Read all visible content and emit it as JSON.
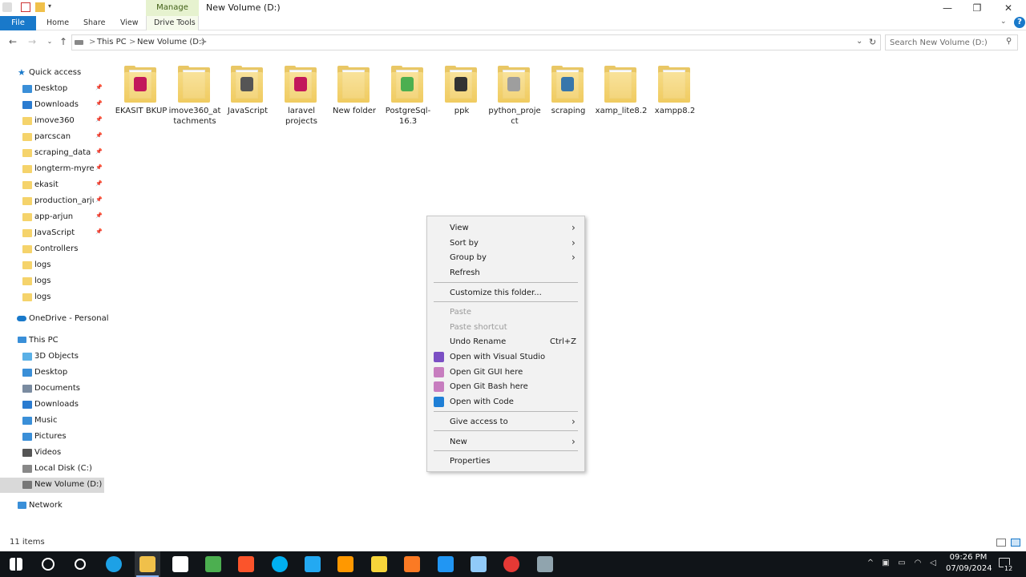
{
  "window": {
    "title": "New Volume (D:)",
    "manage_tab": "Manage",
    "controls": {
      "minimize": "—",
      "maximize": "❐",
      "close": "✕"
    }
  },
  "ribbon": {
    "tabs": [
      {
        "label": "File"
      },
      {
        "label": "Home"
      },
      {
        "label": "Share"
      },
      {
        "label": "View"
      },
      {
        "label": "Drive Tools"
      }
    ],
    "help": "?"
  },
  "address": {
    "crumbs": [
      "This PC",
      "New Volume (D:)"
    ],
    "separator": ">",
    "search_placeholder": "Search New Volume (D:)"
  },
  "nav_pane": {
    "quick_access": "Quick access",
    "quick_items": [
      {
        "label": "Desktop",
        "pinned": true
      },
      {
        "label": "Downloads",
        "pinned": true
      },
      {
        "label": "imove360",
        "pinned": true
      },
      {
        "label": "parcscan",
        "pinned": true
      },
      {
        "label": "scraping_data",
        "pinned": true
      },
      {
        "label": "longterm-myrent",
        "pinned": true
      },
      {
        "label": "ekasit",
        "pinned": true
      },
      {
        "label": "production_arjun",
        "pinned": true
      },
      {
        "label": "app-arjun",
        "pinned": true
      },
      {
        "label": "JavaScript",
        "pinned": true
      },
      {
        "label": "Controllers",
        "pinned": false
      },
      {
        "label": "logs",
        "pinned": false
      },
      {
        "label": "logs",
        "pinned": false
      },
      {
        "label": "logs",
        "pinned": false
      }
    ],
    "onedrive": "OneDrive - Personal",
    "this_pc": "This PC",
    "pc_items": [
      {
        "label": "3D Objects"
      },
      {
        "label": "Desktop"
      },
      {
        "label": "Documents"
      },
      {
        "label": "Downloads"
      },
      {
        "label": "Music"
      },
      {
        "label": "Pictures"
      },
      {
        "label": "Videos"
      },
      {
        "label": "Local Disk (C:)"
      },
      {
        "label": "New Volume (D:)"
      }
    ],
    "network": "Network"
  },
  "files": [
    {
      "name": "EKASIT BKUP",
      "badge": "#c2185b"
    },
    {
      "name": "imove360_attachments",
      "badge": ""
    },
    {
      "name": "JavaScript",
      "badge": "#555555"
    },
    {
      "name": "laravel projects",
      "badge": "#c2185b"
    },
    {
      "name": "New folder",
      "badge": ""
    },
    {
      "name": "PostgreSql-16.3",
      "badge": "#4caf50"
    },
    {
      "name": "ppk",
      "badge": "#333333"
    },
    {
      "name": "python_project",
      "badge": "#9e9e9e"
    },
    {
      "name": "scraping",
      "badge": "#3776ab"
    },
    {
      "name": "xamp_lite8.2",
      "badge": ""
    },
    {
      "name": "xampp8.2",
      "badge": ""
    }
  ],
  "context_menu": {
    "items": [
      {
        "label": "View",
        "submenu": true
      },
      {
        "label": "Sort by",
        "submenu": true
      },
      {
        "label": "Group by",
        "submenu": true
      },
      {
        "label": "Refresh"
      },
      {
        "label": "Customize this folder..."
      },
      {
        "label": "Paste",
        "disabled": true
      },
      {
        "label": "Paste shortcut",
        "disabled": true
      },
      {
        "label": "Undo Rename",
        "shortcut": "Ctrl+Z"
      },
      {
        "label": "Open with Visual Studio",
        "icon": "visual-studio-icon",
        "color": "#7b4fc4"
      },
      {
        "label": "Open Git GUI here",
        "icon": "git-gui-icon",
        "color": "#c77dbf"
      },
      {
        "label": "Open Git Bash here",
        "icon": "git-bash-icon",
        "color": "#c77dbf"
      },
      {
        "label": "Open with Code",
        "icon": "vscode-icon",
        "color": "#1f7fd6"
      },
      {
        "label": "Give access to",
        "submenu": true
      },
      {
        "label": "New",
        "submenu": true
      },
      {
        "label": "Properties"
      }
    ]
  },
  "status": {
    "count": "11 items"
  },
  "taskbar": {
    "apps": [
      {
        "name": "start-icon",
        "color": "#ffffff"
      },
      {
        "name": "search-icon",
        "color": "#ffffff"
      },
      {
        "name": "task-view-icon",
        "color": "#ffffff"
      },
      {
        "name": "edge-icon",
        "color": "#1da1e6"
      },
      {
        "name": "file-explorer-icon",
        "color": "#f0c04a"
      },
      {
        "name": "store-icon",
        "color": "#ffffff"
      },
      {
        "name": "network-app-icon",
        "color": "#4caf50"
      },
      {
        "name": "brave-icon",
        "color": "#fb542b"
      },
      {
        "name": "skype-icon",
        "color": "#00aff0"
      },
      {
        "name": "vscode-icon",
        "color": "#23a9f2"
      },
      {
        "name": "sublime-icon",
        "color": "#ff9800"
      },
      {
        "name": "sticky-notes-icon",
        "color": "#f7d53a"
      },
      {
        "name": "xampp-icon",
        "color": "#fb7a24"
      },
      {
        "name": "app-icon",
        "color": "#2196f3"
      },
      {
        "name": "notepad-icon",
        "color": "#90caf9"
      },
      {
        "name": "chrome-icon",
        "color": "#e53935"
      },
      {
        "name": "calculator-icon",
        "color": "#90a4ae"
      }
    ],
    "clock_time": "09:26 PM",
    "clock_date": "07/09/2024",
    "notifications": "12"
  }
}
